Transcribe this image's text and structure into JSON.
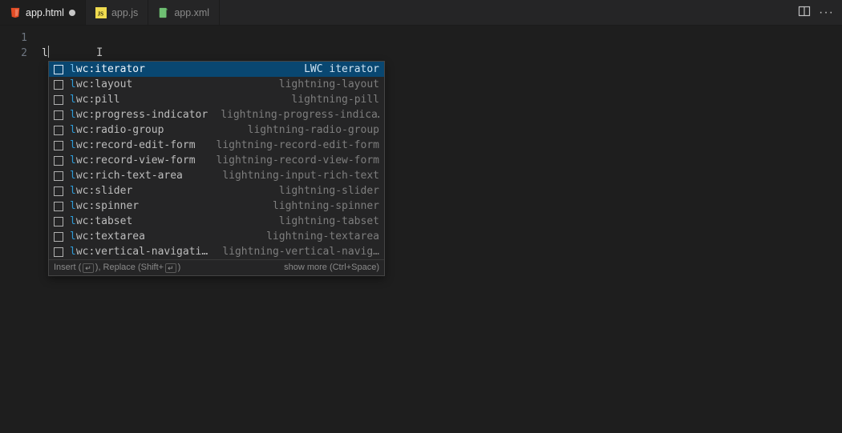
{
  "tabs": [
    {
      "label": "app.html",
      "icon": "html5",
      "active": true,
      "dirty": true
    },
    {
      "label": "app.js",
      "icon": "js",
      "active": false,
      "dirty": false
    },
    {
      "label": "app.xml",
      "icon": "xml",
      "active": false,
      "dirty": false
    }
  ],
  "gutter": {
    "lines": [
      "1",
      "2"
    ]
  },
  "editor": {
    "line1": "",
    "line2_typed": "l"
  },
  "suggest": {
    "filter": "l",
    "items": [
      {
        "label_match": "l",
        "label_rest": "wc:iterator",
        "detail": "LWC iterator",
        "selected": true
      },
      {
        "label_match": "l",
        "label_rest": "wc:layout",
        "detail": "lightning-layout",
        "selected": false
      },
      {
        "label_match": "l",
        "label_rest": "wc:pill",
        "detail": "lightning-pill",
        "selected": false
      },
      {
        "label_match": "l",
        "label_rest": "wc:progress-indicator",
        "detail": "lightning-progress-indica…",
        "selected": false
      },
      {
        "label_match": "l",
        "label_rest": "wc:radio-group",
        "detail": "lightning-radio-group",
        "selected": false
      },
      {
        "label_match": "l",
        "label_rest": "wc:record-edit-form",
        "detail": "lightning-record-edit-form",
        "selected": false
      },
      {
        "label_match": "l",
        "label_rest": "wc:record-view-form",
        "detail": "lightning-record-view-form",
        "selected": false
      },
      {
        "label_match": "l",
        "label_rest": "wc:rich-text-area",
        "detail": "lightning-input-rich-text",
        "selected": false
      },
      {
        "label_match": "l",
        "label_rest": "wc:slider",
        "detail": "lightning-slider",
        "selected": false
      },
      {
        "label_match": "l",
        "label_rest": "wc:spinner",
        "detail": "lightning-spinner",
        "selected": false
      },
      {
        "label_match": "l",
        "label_rest": "wc:tabset",
        "detail": "lightning-tabset",
        "selected": false
      },
      {
        "label_match": "l",
        "label_rest": "wc:textarea",
        "detail": "lightning-textarea",
        "selected": false
      },
      {
        "label_match": "l",
        "label_rest": "wc:vertical-navigati…",
        "detail": "lightning-vertical-navig…",
        "selected": false
      }
    ],
    "status_left_insert": "Insert (",
    "status_left_replace": "), Replace (Shift+",
    "status_left_close": ")",
    "status_right": "show more (Ctrl+Space)"
  },
  "icons": {
    "html5_color": "#e44d26",
    "js_color": "#f0db4f",
    "xml_color": "#6fbf73"
  }
}
